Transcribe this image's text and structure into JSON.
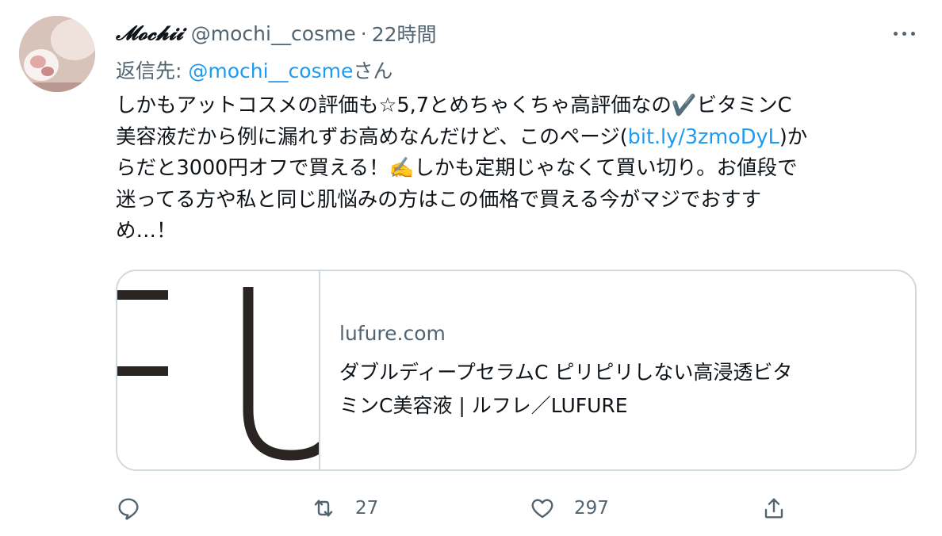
{
  "tweet": {
    "display_name": "𝓜𝓸𝓬𝓱𝓲𝓲",
    "handle": "@mochi__cosme",
    "separator": "·",
    "time": "22時間",
    "reply_prefix": "返信先: ",
    "reply_mention": "@mochi__cosme",
    "reply_suffix": "さん",
    "text": {
      "l1": "しかもアットコスメの評価も☆5,7とめちゃくちゃ高評価なの✔️ビタミンC",
      "l2a": "美容液だから例に漏れずお高めなんだけど、このページ(",
      "link": "bit.ly/3zmoDyL",
      "l2b": ")か",
      "l3": "らだと3000円オフで買える！✍️しかも定期じゃなくて買い切り。お値段で",
      "l4": "迷ってる方や私と同じ肌悩みの方はこの価格で買える今がマジでおすす",
      "l5": "め…！"
    }
  },
  "card": {
    "domain": "lufure.com",
    "title_line1": "ダブルディープセラムC ピリピリしない高浸透ビタ",
    "title_line2": "ミンC美容液 | ルフレ／LUFURE"
  },
  "actions": {
    "reply_count": "",
    "retweet_count": "27",
    "like_count": "297"
  },
  "colors": {
    "link": "#1d9bf0",
    "secondary_text": "#536471",
    "border": "#cfd9de"
  }
}
